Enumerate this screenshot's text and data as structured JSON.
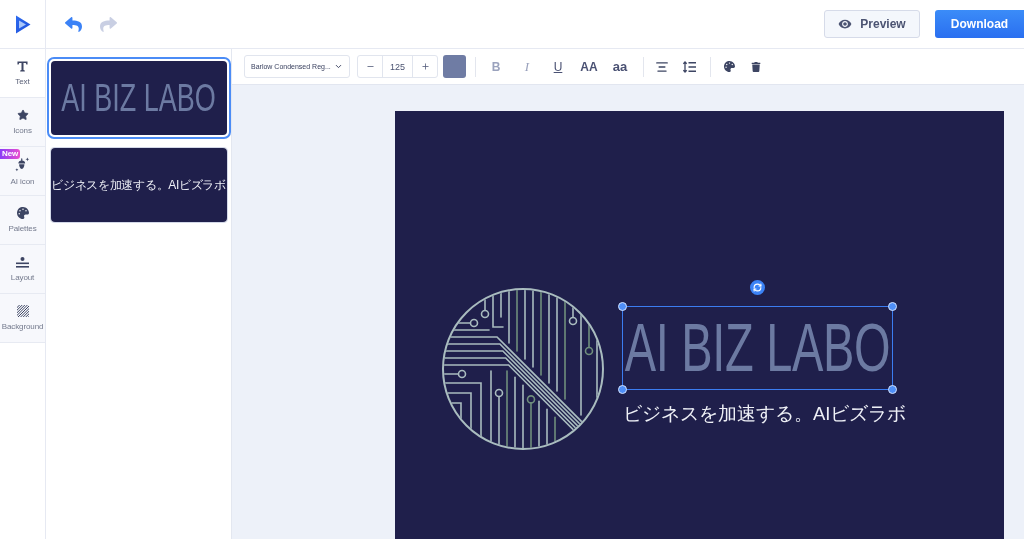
{
  "header": {
    "history": [
      {
        "kind": "undo",
        "disabled": false
      },
      {
        "kind": "redo",
        "disabled": true
      }
    ],
    "actions": [
      {
        "kind": "secondary",
        "label": "Preview"
      },
      {
        "kind": "primary",
        "label": "Download"
      }
    ]
  },
  "sidebar": {
    "items": [
      {
        "kind": "text",
        "label": "Text",
        "selected": true
      },
      {
        "kind": "icons",
        "label": "Icons",
        "selected": false
      },
      {
        "kind": "ai_icon",
        "label": "AI icon",
        "selected": false,
        "badge": "New"
      },
      {
        "kind": "palettes",
        "label": "Palettes",
        "selected": false
      },
      {
        "kind": "layout",
        "label": "Layout",
        "selected": false
      },
      {
        "kind": "background",
        "label": "Background",
        "selected": false
      }
    ]
  },
  "pages": [
    {
      "kind": "title",
      "text": "AI BIZ LABO",
      "selected": true
    },
    {
      "kind": "tagline",
      "text": "ビジネスを加速する。AIビズラボ",
      "selected": false
    }
  ],
  "toolbar": {
    "font": "Barlow Condensed Reg...",
    "font_size": "125",
    "color": "#6f7ca4",
    "tool_groups": [
      {
        "tools": [
          {
            "kind": "bold",
            "label": "B",
            "disabled": true
          },
          {
            "kind": "italic",
            "label": "I",
            "disabled": true
          },
          {
            "kind": "underline",
            "label": "U",
            "disabled": false
          },
          {
            "kind": "uppercase",
            "label": "AA",
            "disabled": false
          },
          {
            "kind": "lowercase",
            "label": "aa",
            "disabled": false
          }
        ]
      },
      {
        "tools": [
          {
            "kind": "align",
            "disabled": false
          },
          {
            "kind": "spacing",
            "disabled": false
          }
        ]
      },
      {
        "tools": [
          {
            "kind": "palette",
            "disabled": false
          },
          {
            "kind": "delete",
            "disabled": false
          }
        ]
      }
    ]
  },
  "canvas": {
    "elements": [
      {
        "kind": "emblem",
        "selected": false
      },
      {
        "kind": "title",
        "text": "AI BIZ LABO",
        "selected": true
      },
      {
        "kind": "tagline",
        "text": "ビジネスを加速する。AIビズラボ",
        "selected": false
      }
    ]
  }
}
